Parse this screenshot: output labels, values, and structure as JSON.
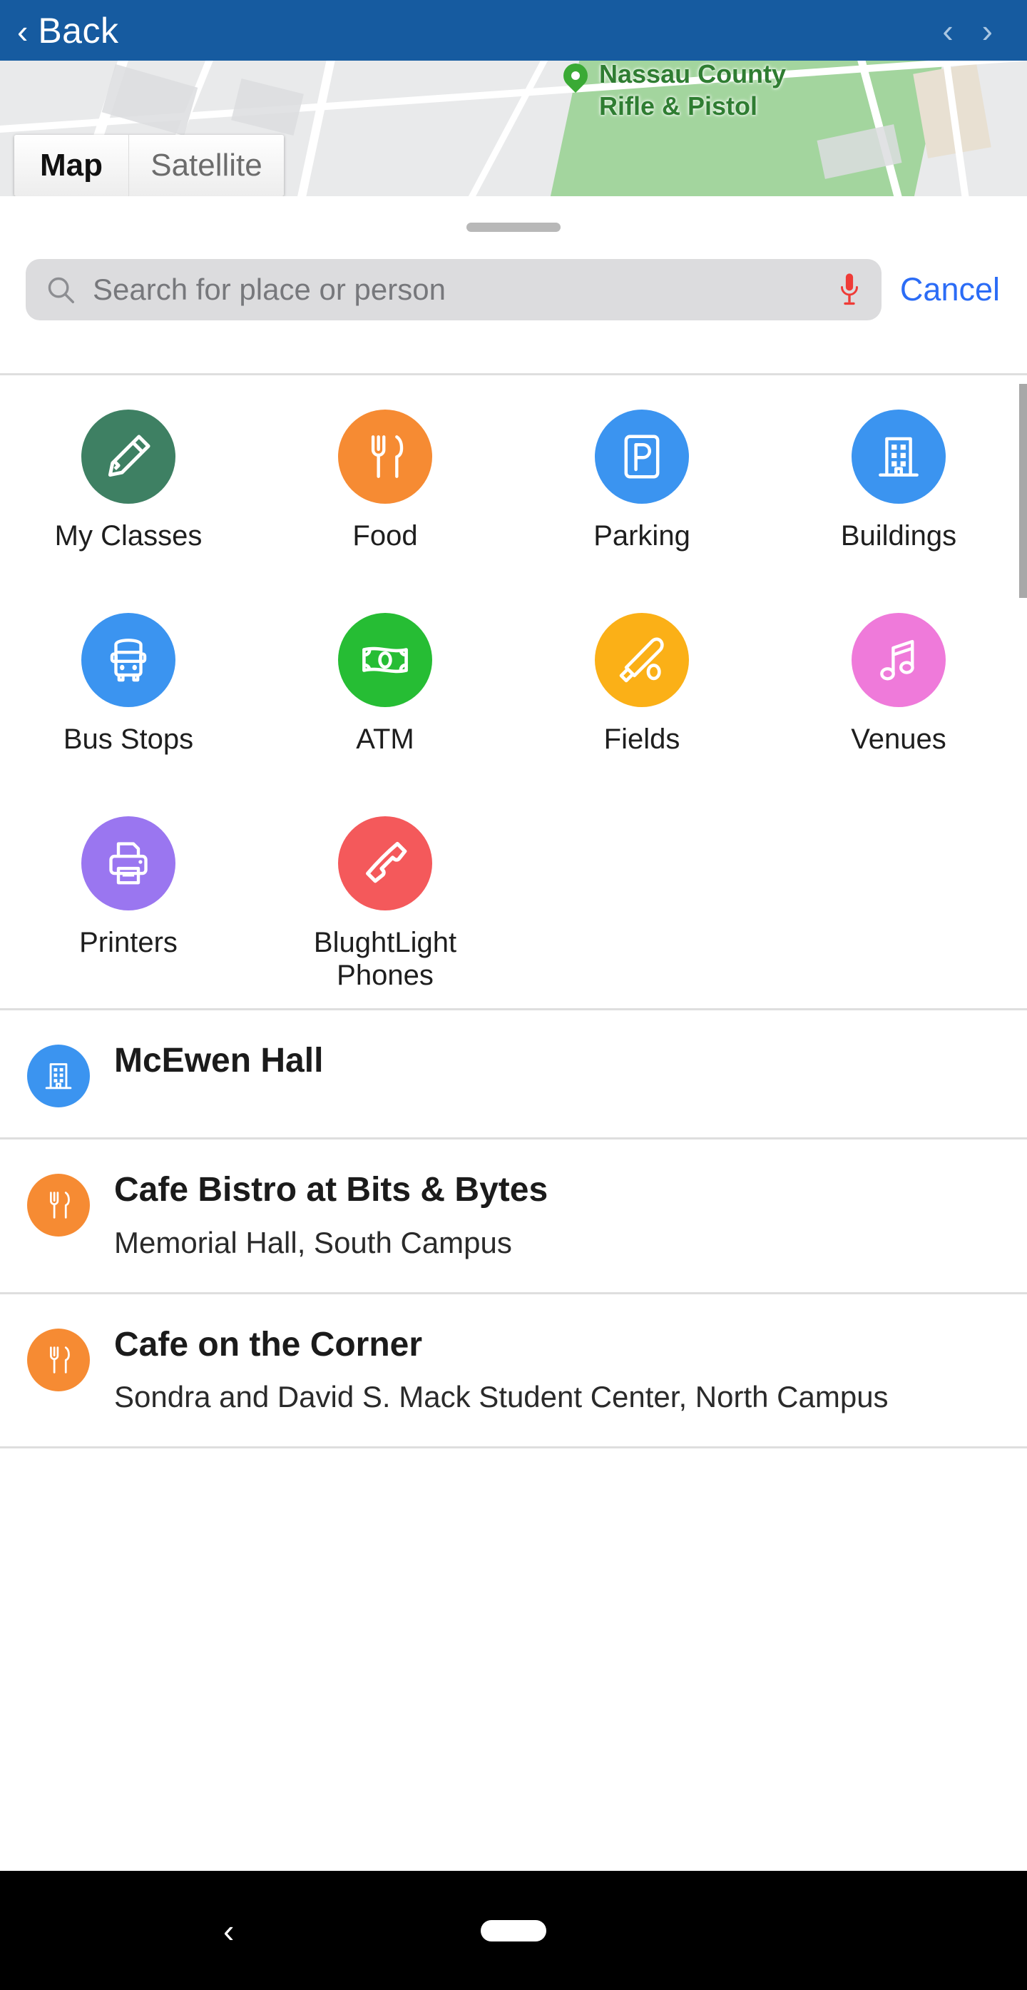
{
  "appbar": {
    "back_label": "Back",
    "back_chevron": "‹",
    "prev_arrow": "‹",
    "next_arrow": "›",
    "background_color": "#165ba0"
  },
  "map": {
    "place_label": "Nassau County\nRifle & Pistol",
    "place_label_line1": "Nassau County",
    "place_label_line2": "Rifle & Pistol",
    "types": [
      {
        "label": "Map",
        "active": true
      },
      {
        "label": "Satellite",
        "active": false
      }
    ]
  },
  "search": {
    "placeholder": "Search for place or person",
    "value": "",
    "cancel_label": "Cancel",
    "mic_color": "#ef3b37",
    "cancel_color": "#2b6cf6"
  },
  "categories": [
    {
      "label": "My Classes",
      "icon": "pencil-icon",
      "color": "#3e8063"
    },
    {
      "label": "Food",
      "icon": "cutlery-icon",
      "color": "#f68b33"
    },
    {
      "label": "Parking",
      "icon": "parking-icon",
      "color": "#3b94f0"
    },
    {
      "label": "Buildings",
      "icon": "building-icon",
      "color": "#3b94f0"
    },
    {
      "label": "Bus Stops",
      "icon": "bus-icon",
      "color": "#3b94f0"
    },
    {
      "label": "ATM",
      "icon": "banknote-icon",
      "color": "#26bd34"
    },
    {
      "label": "Fields",
      "icon": "baseball-bat-icon",
      "color": "#fbb017"
    },
    {
      "label": "Venues",
      "icon": "music-note-icon",
      "color": "#ef7ada"
    },
    {
      "label": "Printers",
      "icon": "printer-icon",
      "color": "#9a76f0"
    },
    {
      "label": "BlughtLight Phones",
      "icon": "phone-icon",
      "color": "#f4595b"
    }
  ],
  "results": [
    {
      "title": "McEwen Hall",
      "subtitle": "",
      "icon": "building-icon",
      "color": "#3b94f0"
    },
    {
      "title": "Cafe Bistro at Bits & Bytes",
      "subtitle": "Memorial Hall, South Campus",
      "icon": "cutlery-icon",
      "color": "#f68b33"
    },
    {
      "title": "Cafe on the Corner",
      "subtitle": "Sondra and David S. Mack Student Center, North Campus",
      "icon": "cutlery-icon",
      "color": "#f68b33"
    }
  ],
  "android_nav": {
    "back_glyph": "‹"
  }
}
